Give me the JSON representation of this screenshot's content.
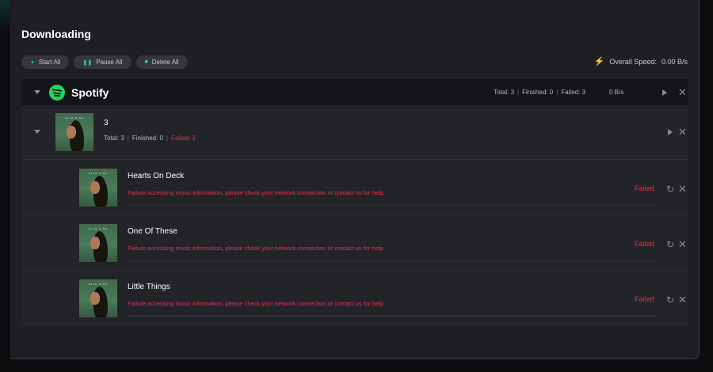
{
  "header": {
    "title": "Downloading"
  },
  "toolbar": {
    "start_all": {
      "icon": "plus-icon",
      "label": "Start All"
    },
    "pause_all": {
      "icon": "pause-icon",
      "label": "Pause All"
    },
    "delete_all": {
      "icon": "trash-icon",
      "label": "Delete All"
    }
  },
  "speed": {
    "icon": "lightning-icon",
    "label": "Overall Speed:",
    "value": "0.00 B/s"
  },
  "colors": {
    "accent": "#1ed3a4",
    "spotify": "#1ed760",
    "error": "#e8304a"
  },
  "platform": {
    "name": "Spotify",
    "icon": "spotify-icon",
    "total": "Total: 3",
    "finished": "Finished: 0",
    "failed": "Failed: 3",
    "speed": "0 B/s"
  },
  "album": {
    "title": "3",
    "cover_text": "ELLE KING",
    "total": "Total: 3",
    "finished": "Finished: 0",
    "failed": "Failed: 3"
  },
  "tracks": [
    {
      "title": "Hearts On Deck",
      "error": "Failure accessing music information, please check your network connection or contact us for help.",
      "status": "Failed",
      "progress": 0
    },
    {
      "title": "One Of These",
      "error": "Failure accessing music information, please check your network connection or contact us for help.",
      "status": "Failed",
      "progress": 0
    },
    {
      "title": "Little Things",
      "error": "Failure accessing music information, please check your network connection or contact us for help.",
      "status": "Failed",
      "progress": 0
    }
  ]
}
